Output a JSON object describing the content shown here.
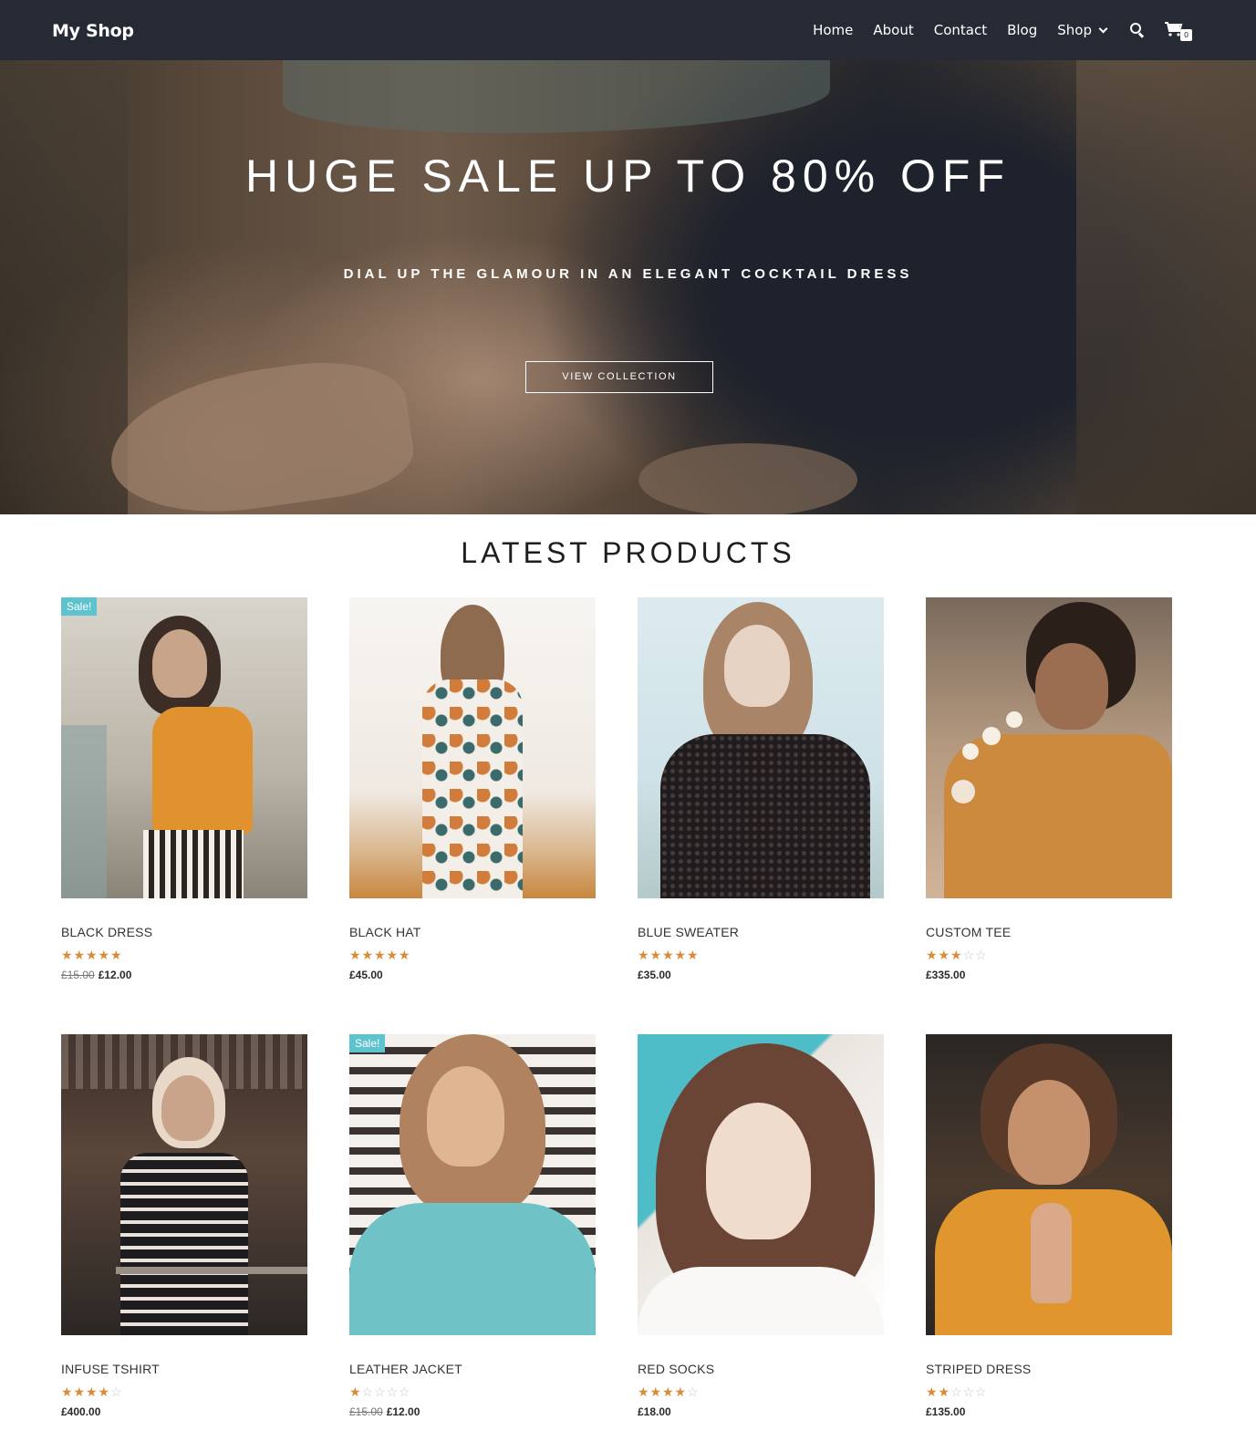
{
  "header": {
    "logo": "My Shop",
    "nav": [
      "Home",
      "About",
      "Contact",
      "Blog",
      "Shop"
    ],
    "cart_count": "0"
  },
  "hero": {
    "title": "HUGE SALE UP TO 80% OFF",
    "subtitle": "DIAL UP THE GLAMOUR IN AN ELEGANT COCKTAIL DRESS",
    "button": "VIEW COLLECTION"
  },
  "section": {
    "title": "LATEST PRODUCTS"
  },
  "products": [
    {
      "name": "BLACK DRESS",
      "rating": 5,
      "old_price": "£15.00",
      "price": "£12.00",
      "sale": "Sale!"
    },
    {
      "name": "BLACK HAT",
      "rating": 5,
      "old_price": "",
      "price": "£45.00",
      "sale": ""
    },
    {
      "name": "BLUE SWEATER",
      "rating": 5,
      "old_price": "",
      "price": "£35.00",
      "sale": ""
    },
    {
      "name": "CUSTOM TEE",
      "rating": 3,
      "old_price": "",
      "price": "£335.00",
      "sale": ""
    },
    {
      "name": "INFUSE TSHIRT",
      "rating": 4,
      "old_price": "",
      "price": "£400.00",
      "sale": ""
    },
    {
      "name": "LEATHER JACKET",
      "rating": 1,
      "old_price": "£15.00",
      "price": "£12.00",
      "sale": "Sale!"
    },
    {
      "name": "RED SOCKS",
      "rating": 4,
      "old_price": "",
      "price": "£18.00",
      "sale": ""
    },
    {
      "name": "STRIPED DRESS",
      "rating": 2,
      "old_price": "",
      "price": "£135.00",
      "sale": ""
    }
  ],
  "colors": {
    "header_bg": "#262a35",
    "accent_orange": "#d88c3a",
    "sale_badge": "#5cc3cf"
  }
}
